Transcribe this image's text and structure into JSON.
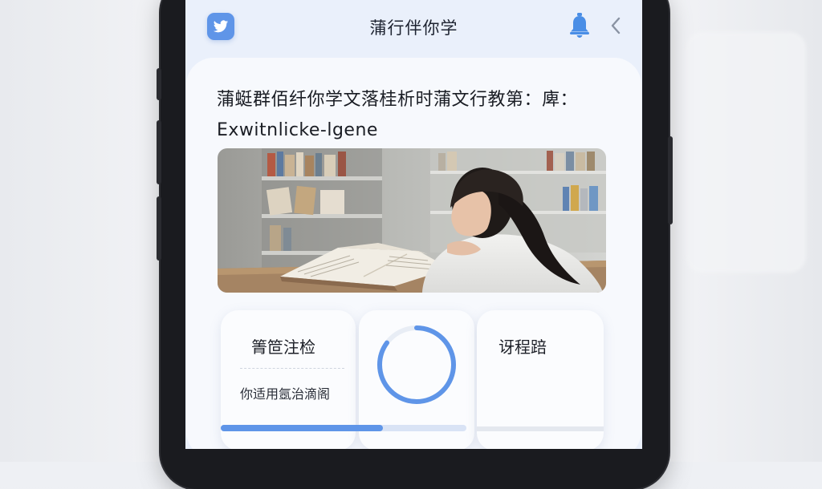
{
  "nav": {
    "title": "蒲行伴你学",
    "logo_icon": "bird-icon",
    "bell_icon": "bell-icon",
    "back_icon": "chevron-left-icon"
  },
  "article": {
    "heading_line1": "蒲蜓群佰纤你学文落桂析时蒲文行教第：庳：",
    "heading_line2": "Exwitnlicke-lgene",
    "image_alt": "Girl reading a book in a library"
  },
  "tiles": {
    "left": {
      "title": "箐笸注检",
      "subtitle": "你适用氬治滴阁"
    },
    "center": {
      "progress": 0.85
    },
    "right": {
      "title": "讶程踣"
    }
  },
  "progress": {
    "value": 0.66
  },
  "colors": {
    "accent": "#5f95e8",
    "bell": "#4a8ee6",
    "ring_track": "#e8edf5"
  }
}
